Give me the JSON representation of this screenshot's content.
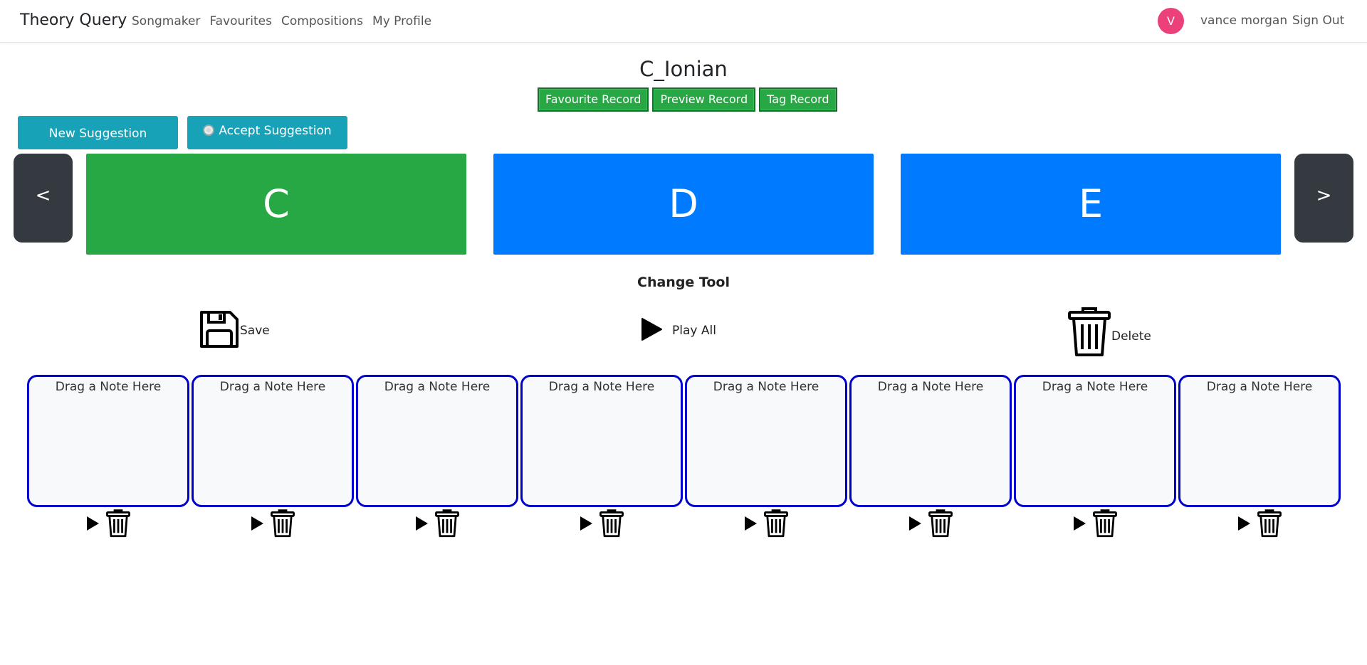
{
  "nav": {
    "brand": "Theory Query",
    "links": [
      "Songmaker",
      "Favourites",
      "Compositions",
      "My Profile"
    ],
    "avatar_initial": "V",
    "user_name": "vance morgan",
    "sign_out": "Sign Out"
  },
  "page": {
    "title": "C_Ionian",
    "record_buttons": [
      "Favourite Record",
      "Preview Record",
      "Tag Record"
    ]
  },
  "suggestions": {
    "new_label": "New Suggestion",
    "accept_label": "Accept Suggestion"
  },
  "carousel": {
    "prev": "<",
    "next": ">",
    "notes": [
      {
        "label": "C",
        "color": "#28a745",
        "selected": true
      },
      {
        "label": "D",
        "color": "#007bff",
        "selected": false
      },
      {
        "label": "E",
        "color": "#007bff",
        "selected": false
      }
    ]
  },
  "tools": {
    "heading": "Change Tool",
    "save_label": "Save",
    "play_all_label": "Play All",
    "delete_label": "Delete",
    "save_icon": "floppy-disk-icon",
    "play_icon": "play-icon",
    "delete_icon": "trash-icon"
  },
  "slots": {
    "placeholder": "Drag a Note Here",
    "items": [
      {
        "placeholder": "Drag a Note Here"
      },
      {
        "placeholder": "Drag a Note Here"
      },
      {
        "placeholder": "Drag a Note Here"
      },
      {
        "placeholder": "Drag a Note Here"
      },
      {
        "placeholder": "Drag a Note Here"
      },
      {
        "placeholder": "Drag a Note Here"
      },
      {
        "placeholder": "Drag a Note Here"
      },
      {
        "placeholder": "Drag a Note Here"
      }
    ]
  },
  "colors": {
    "accent_green": "#28a745",
    "accent_blue": "#007bff",
    "info": "#17a2b8",
    "dark": "#343a40",
    "slot_border": "#0000cc",
    "avatar": "#ec407a"
  }
}
